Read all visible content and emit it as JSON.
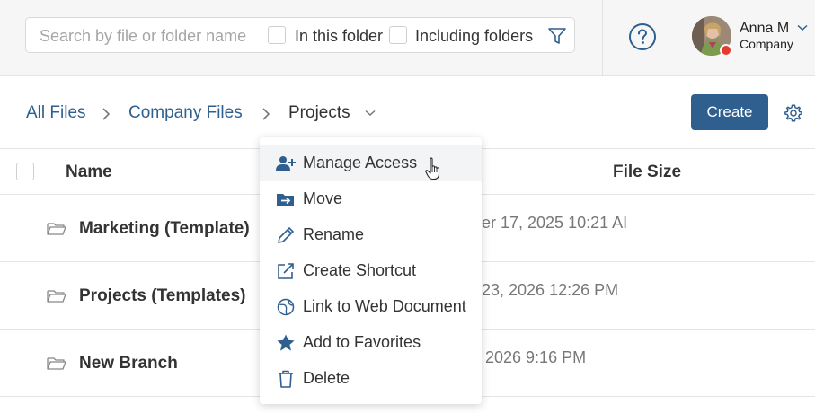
{
  "search": {
    "placeholder": "Search by file or folder name",
    "in_folder_label": "In this folder",
    "including_folders_label": "Including folders"
  },
  "user": {
    "name": "Anna M",
    "company": "Company"
  },
  "breadcrumb": {
    "items": [
      "All Files",
      "Company Files",
      "Projects"
    ]
  },
  "toolbar": {
    "create_label": "Create"
  },
  "table": {
    "columns": [
      "Name",
      "File Size"
    ],
    "rows": [
      {
        "name": "Marketing (Template)",
        "date": "er 17, 2025 10:21 AI"
      },
      {
        "name": "Projects (Templates)",
        "date": "23, 2026 12:26 PM"
      },
      {
        "name": "New Branch",
        "date": "2026 9:16 PM"
      }
    ]
  },
  "menu": {
    "items": [
      {
        "label": "Manage Access",
        "icon": "manage-access-icon"
      },
      {
        "label": "Move",
        "icon": "move-icon"
      },
      {
        "label": "Rename",
        "icon": "pencil-icon"
      },
      {
        "label": "Create Shortcut",
        "icon": "external-link-icon"
      },
      {
        "label": "Link to Web Document",
        "icon": "globe-link-icon"
      },
      {
        "label": "Add to Favorites",
        "icon": "star-icon"
      },
      {
        "label": "Delete",
        "icon": "trash-icon"
      }
    ]
  },
  "colors": {
    "accent": "#2f5f8f",
    "status_dot": "#e53b2d"
  }
}
